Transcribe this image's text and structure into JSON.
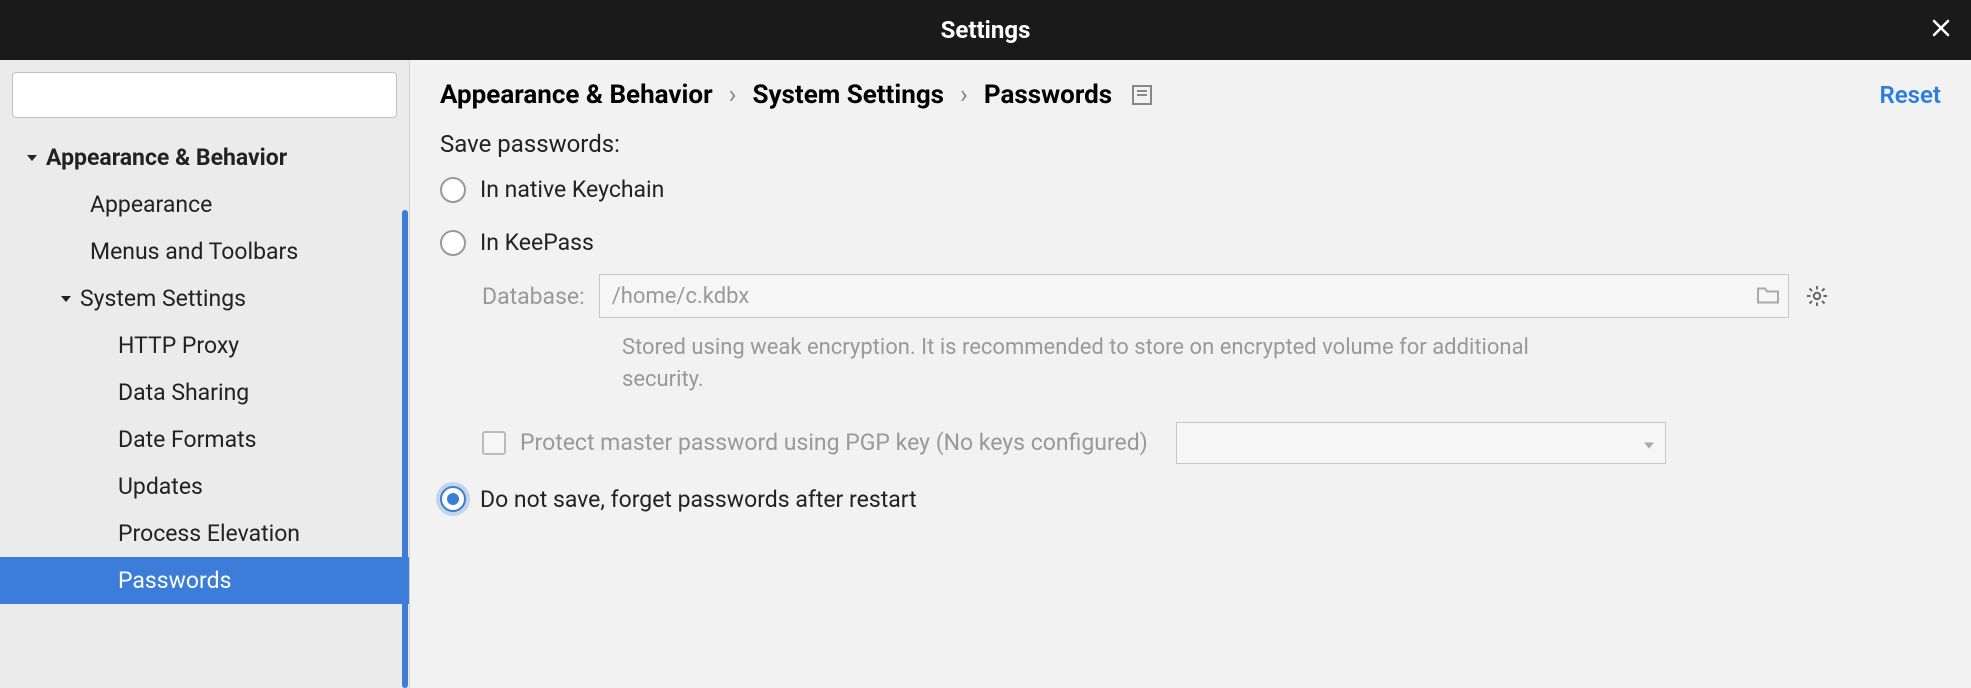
{
  "window": {
    "title": "Settings"
  },
  "sidebar": {
    "search_placeholder": "",
    "items": [
      {
        "label": "Appearance & Behavior",
        "bold": true,
        "indent": 0,
        "expandable": true,
        "expanded": true
      },
      {
        "label": "Appearance",
        "indent": 2
      },
      {
        "label": "Menus and Toolbars",
        "indent": 2
      },
      {
        "label": "System Settings",
        "indent": 1,
        "expandable": true,
        "expanded": true
      },
      {
        "label": "HTTP Proxy",
        "indent": 3
      },
      {
        "label": "Data Sharing",
        "indent": 3
      },
      {
        "label": "Date Formats",
        "indent": 3
      },
      {
        "label": "Updates",
        "indent": 3
      },
      {
        "label": "Process Elevation",
        "indent": 3
      },
      {
        "label": "Passwords",
        "indent": 3,
        "selected": true
      }
    ]
  },
  "breadcrumb": {
    "parts": [
      "Appearance & Behavior",
      "System Settings",
      "Passwords"
    ],
    "reset": "Reset"
  },
  "passwords": {
    "section_label": "Save passwords:",
    "opt_keychain": "In native Keychain",
    "opt_keepass": "In KeePass",
    "db_label": "Database:",
    "db_value": "/home/c.kdbx",
    "hint": "Stored using weak encryption. It is recommended to store on encrypted volume for additional security.",
    "pgp_label": "Protect master password using PGP key (No keys configured)",
    "opt_forget": "Do not save, forget passwords after restart",
    "selected": "forget"
  }
}
